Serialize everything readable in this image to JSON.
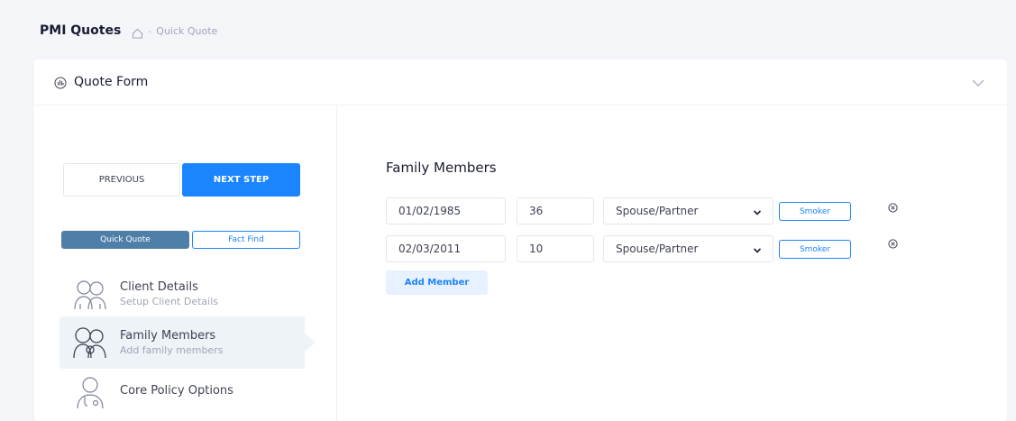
{
  "breadcrumb": {
    "title": "PMI Quotes",
    "home_icon": "home-icon",
    "separator": "-",
    "current": "Quick Quote"
  },
  "card": {
    "title": "Quote Form",
    "title_icon": "chart-circle-icon",
    "toggle_icon": "chevron-down-icon"
  },
  "nav": {
    "previous_label": "PREVIOUS",
    "next_label": "NEXT STEP",
    "quick_quote_label": "Quick Quote",
    "fact_find_label": "Fact Find"
  },
  "steps": [
    {
      "title": "Client Details",
      "desc": "Setup Client Details",
      "icon": "couple-icon"
    },
    {
      "title": "Family Members",
      "desc": "Add family members",
      "icon": "family-icon"
    },
    {
      "title": "Core Policy Options",
      "desc": "",
      "icon": "doctor-icon"
    }
  ],
  "form": {
    "section_title": "Family Members",
    "members": [
      {
        "dob": "01/02/1985",
        "age": "36",
        "relationship": "Spouse/Partner",
        "smoker_label": "Smoker"
      },
      {
        "dob": "02/03/2011",
        "age": "10",
        "relationship": "Spouse/Partner",
        "smoker_label": "Smoker"
      }
    ],
    "add_member_label": "Add Member"
  },
  "colors": {
    "primary": "#1b84ff",
    "active_toggle": "#4e7fa8",
    "page_bg": "#f3f5f9"
  }
}
